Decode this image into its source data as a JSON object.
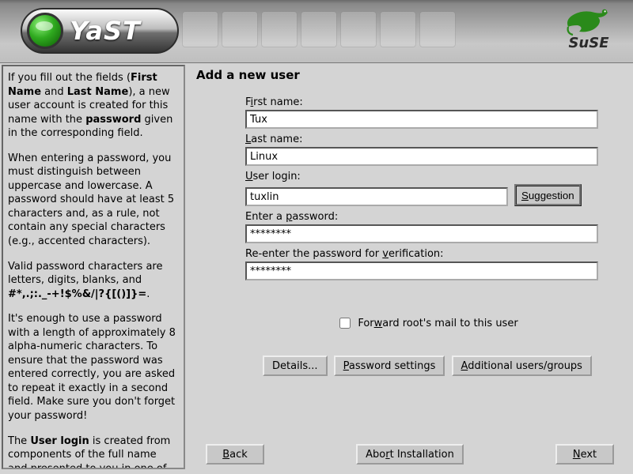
{
  "brand": {
    "yast": "YaST",
    "suse": "SuSE"
  },
  "help": {
    "p1a": "If you fill out the fields (",
    "p1b": "First Name",
    "p1c": " and ",
    "p1d": "Last Name",
    "p1e": "), a new user account is created for this name with the ",
    "p1f": "password",
    "p1g": " given in the corresponding field.",
    "p2": "When entering a password, you must distinguish between uppercase and lowercase. A password should have at least 5 characters and, as a rule, not contain any special characters (e.g., accented characters).",
    "p3a": "Valid password characters are letters, digits, blanks, and ",
    "p3b": "#*,.;:._-+!$%&/|?{[()]}=",
    "p3c": ".",
    "p4": "It's enough to use a password with a length of approximately 8 alpha-numeric characters. To ensure that the password was entered correctly, you are asked to repeat it exactly in a second field. Make sure you don't forget your password!",
    "p5a": "The ",
    "p5b": "User login",
    "p5c": " is created from components of the full name and presented to you in one of"
  },
  "main": {
    "title": "Add a new user",
    "labels": {
      "first_pre": "F",
      "first_ul": "i",
      "first_post": "rst name:",
      "last_ul": "L",
      "last_post": "ast name:",
      "login_ul": "U",
      "login_post": "ser login:",
      "pw_pre": "Enter a ",
      "pw_ul": "p",
      "pw_post": "assword:",
      "pw2_pre": "Re-enter the password for ",
      "pw2_ul": "v",
      "pw2_post": "erification:",
      "fwd_pre": "For",
      "fwd_ul": "w",
      "fwd_post": "ard root's mail to this user"
    },
    "values": {
      "first": "Tux",
      "last": "Linux",
      "login": "tuxlin",
      "pw": "********",
      "pw2": "********"
    },
    "buttons": {
      "sugg_ul": "S",
      "sugg_post": "uggestion",
      "details": "Details...",
      "pws": "Password settings",
      "addl": "Additional users/groups",
      "back_ul": "B",
      "back_post": "ack",
      "abort_pre": "Abo",
      "abort_ul": "r",
      "abort_post": "t Installation",
      "next_ul": "N",
      "next_post": "ext"
    }
  }
}
